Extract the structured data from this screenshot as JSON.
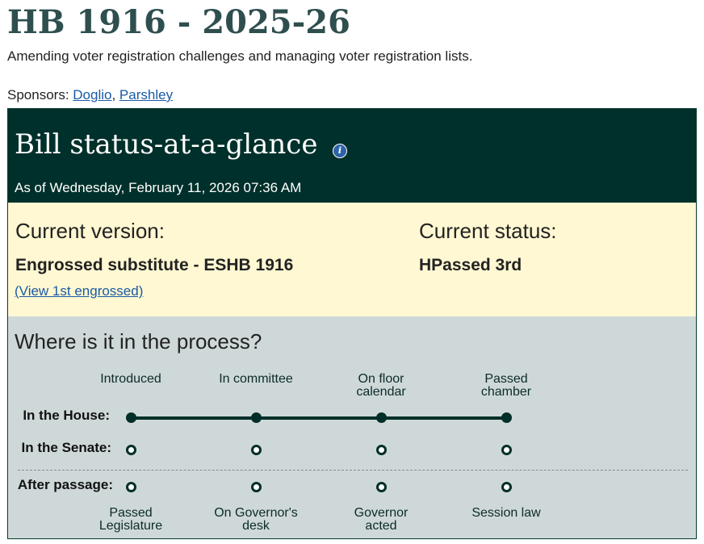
{
  "bill": {
    "title": "HB 1916 - 2025-26",
    "description": "Amending voter registration challenges and managing voter registration lists.",
    "sponsors_label": "Sponsors: ",
    "sponsors": [
      "Doglio",
      "Parshley"
    ],
    "sponsor_separator": ", "
  },
  "status_panel": {
    "heading": "Bill status-at-a-glance",
    "info_icon": "info-icon",
    "as_of": "As of Wednesday, February 11, 2026 07:36 AM",
    "current_version_label": "Current version:",
    "current_version_value": "Engrossed substitute - ESHB 1916",
    "view_link": "(View 1st engrossed)",
    "current_status_label": "Current status:",
    "current_status_value": "HPassed 3rd"
  },
  "process": {
    "heading": "Where is it in the process?",
    "top_stages": [
      "Introduced",
      "In committee",
      "On floor\ncalendar",
      "Passed\nchamber"
    ],
    "rows": [
      {
        "label": "In the House:",
        "completed": 4,
        "total": 4
      },
      {
        "label": "In the Senate:",
        "completed": 0,
        "total": 4
      },
      {
        "label": "After passage:",
        "completed": 0,
        "total": 4
      }
    ],
    "bottom_stages": [
      "Passed\nLegislature",
      "On Governor's\ndesk",
      "Governor\nacted",
      "Session law"
    ]
  },
  "colors": {
    "title": "#2f4f4f",
    "header_bg": "#00302b",
    "version_bg": "#fff8d2",
    "process_bg": "#cfd8d8",
    "link": "#1a5aa6"
  }
}
